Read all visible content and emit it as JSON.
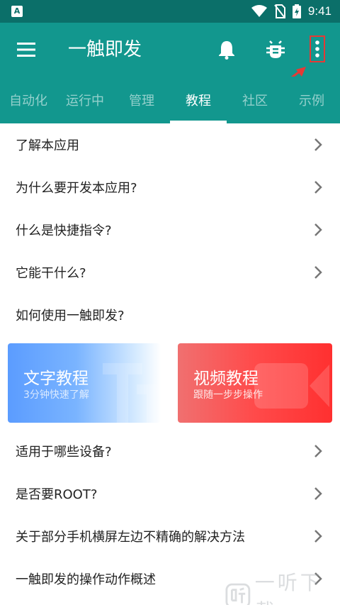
{
  "status_bar": {
    "time": "9:41",
    "app_badge": "A",
    "icons": [
      "wifi-icon",
      "no-sim-icon",
      "battery-charging-icon"
    ]
  },
  "toolbar": {
    "title": "一触即发",
    "icons": [
      "menu-icon",
      "bell-icon",
      "bug-icon",
      "more-vertical-icon"
    ]
  },
  "tabs": [
    {
      "label": "自动化",
      "active": false
    },
    {
      "label": "运行中",
      "active": false
    },
    {
      "label": "管理",
      "active": false
    },
    {
      "label": "教程",
      "active": true
    },
    {
      "label": "社区",
      "active": false
    },
    {
      "label": "示例",
      "active": false
    }
  ],
  "items_top": [
    {
      "label": "了解本应用",
      "chevron": true
    },
    {
      "label": "为什么要开发本应用?",
      "chevron": true
    },
    {
      "label": "什么是快捷指令?",
      "chevron": true
    },
    {
      "label": "它能干什么?",
      "chevron": true
    },
    {
      "label": "如何使用一触即发?",
      "chevron": false
    }
  ],
  "cards": {
    "text": {
      "title": "文字教程",
      "subtitle": "3分钟快速了解"
    },
    "video": {
      "title": "视频教程",
      "subtitle": "跟随一步步操作"
    }
  },
  "items_bottom": [
    {
      "label": "适用于哪些设备?"
    },
    {
      "label": "是否要ROOT?"
    },
    {
      "label": "关于部分手机横屏左边不精确的解决方法"
    },
    {
      "label": "一触即发的操作动作概述"
    }
  ],
  "watermark": {
    "text": "一听下载"
  },
  "colors": {
    "status_bar": "#0b6f69",
    "toolbar": "#12978e",
    "highlight": "#e53935"
  }
}
